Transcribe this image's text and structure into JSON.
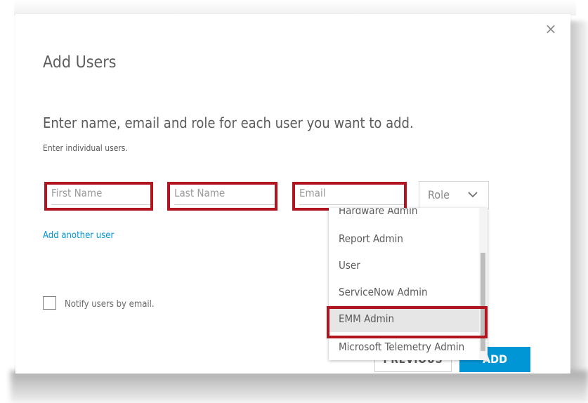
{
  "dialog": {
    "title": "Add Users",
    "instructions": "Enter name, email and role for each user you want to add.",
    "subtext": "Enter individual users.",
    "close_label": "×"
  },
  "form": {
    "first_name_placeholder": "First Name",
    "last_name_placeholder": "Last Name",
    "email_placeholder": "Email",
    "role_label": "Role",
    "add_another_label": "Add another user",
    "notify_label": "Notify users by email.",
    "notify_checked": false
  },
  "role_dropdown": {
    "items": [
      {
        "label": "Hardware Admin"
      },
      {
        "label": "Report Admin"
      },
      {
        "label": "User"
      },
      {
        "label": "ServiceNow Admin"
      },
      {
        "label": "EMM Admin",
        "selected": true
      },
      {
        "label": "Microsoft Telemetry Admin"
      }
    ]
  },
  "buttons": {
    "previous_label": "PREVIOUS",
    "add_label": "ADD"
  },
  "colors": {
    "accent": "#0096d6",
    "highlight_border": "#b0141e",
    "selected_bg": "#e6e6e6"
  }
}
